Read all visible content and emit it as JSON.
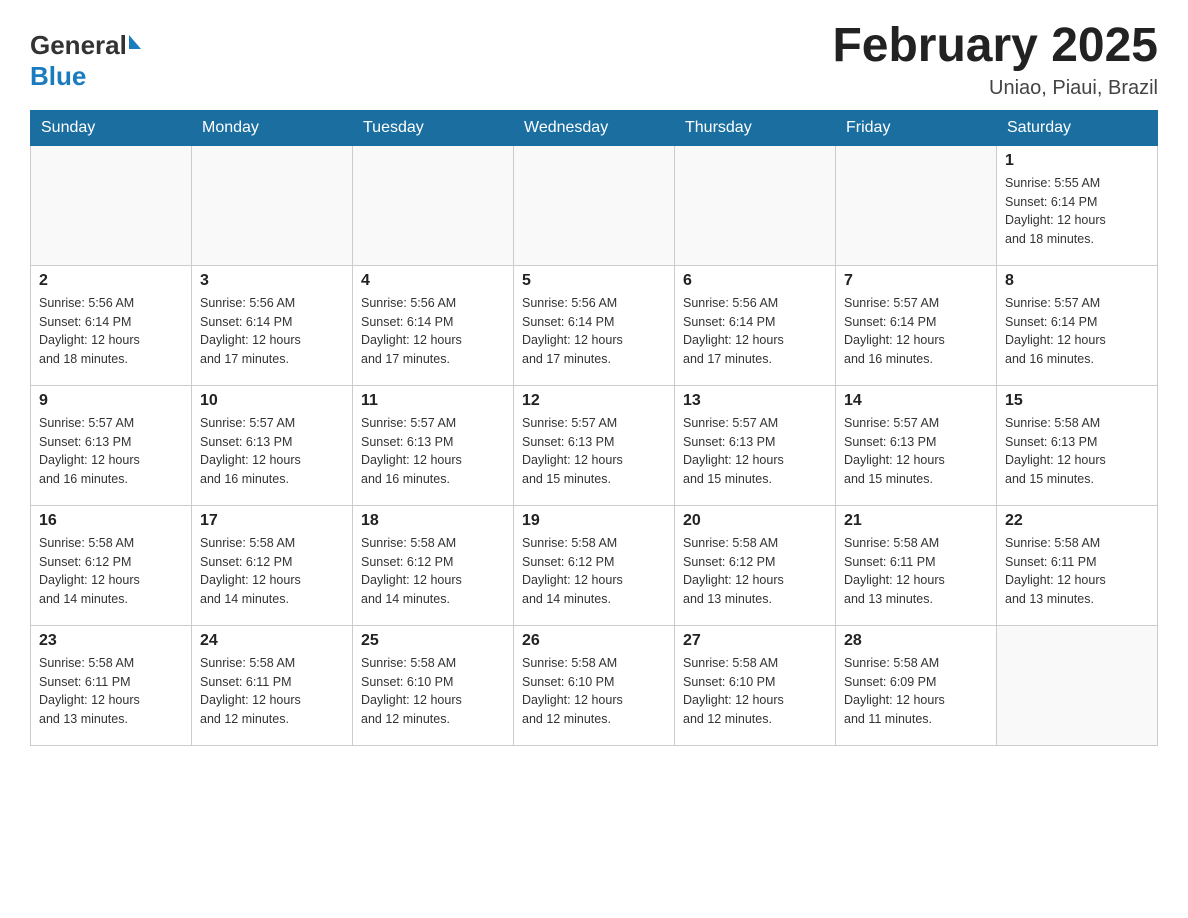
{
  "header": {
    "logo_general": "General",
    "logo_blue": "Blue",
    "month_title": "February 2025",
    "location": "Uniao, Piaui, Brazil"
  },
  "days_of_week": [
    "Sunday",
    "Monday",
    "Tuesday",
    "Wednesday",
    "Thursday",
    "Friday",
    "Saturday"
  ],
  "weeks": [
    [
      {
        "day": "",
        "info": ""
      },
      {
        "day": "",
        "info": ""
      },
      {
        "day": "",
        "info": ""
      },
      {
        "day": "",
        "info": ""
      },
      {
        "day": "",
        "info": ""
      },
      {
        "day": "",
        "info": ""
      },
      {
        "day": "1",
        "info": "Sunrise: 5:55 AM\nSunset: 6:14 PM\nDaylight: 12 hours\nand 18 minutes."
      }
    ],
    [
      {
        "day": "2",
        "info": "Sunrise: 5:56 AM\nSunset: 6:14 PM\nDaylight: 12 hours\nand 18 minutes."
      },
      {
        "day": "3",
        "info": "Sunrise: 5:56 AM\nSunset: 6:14 PM\nDaylight: 12 hours\nand 17 minutes."
      },
      {
        "day": "4",
        "info": "Sunrise: 5:56 AM\nSunset: 6:14 PM\nDaylight: 12 hours\nand 17 minutes."
      },
      {
        "day": "5",
        "info": "Sunrise: 5:56 AM\nSunset: 6:14 PM\nDaylight: 12 hours\nand 17 minutes."
      },
      {
        "day": "6",
        "info": "Sunrise: 5:56 AM\nSunset: 6:14 PM\nDaylight: 12 hours\nand 17 minutes."
      },
      {
        "day": "7",
        "info": "Sunrise: 5:57 AM\nSunset: 6:14 PM\nDaylight: 12 hours\nand 16 minutes."
      },
      {
        "day": "8",
        "info": "Sunrise: 5:57 AM\nSunset: 6:14 PM\nDaylight: 12 hours\nand 16 minutes."
      }
    ],
    [
      {
        "day": "9",
        "info": "Sunrise: 5:57 AM\nSunset: 6:13 PM\nDaylight: 12 hours\nand 16 minutes."
      },
      {
        "day": "10",
        "info": "Sunrise: 5:57 AM\nSunset: 6:13 PM\nDaylight: 12 hours\nand 16 minutes."
      },
      {
        "day": "11",
        "info": "Sunrise: 5:57 AM\nSunset: 6:13 PM\nDaylight: 12 hours\nand 16 minutes."
      },
      {
        "day": "12",
        "info": "Sunrise: 5:57 AM\nSunset: 6:13 PM\nDaylight: 12 hours\nand 15 minutes."
      },
      {
        "day": "13",
        "info": "Sunrise: 5:57 AM\nSunset: 6:13 PM\nDaylight: 12 hours\nand 15 minutes."
      },
      {
        "day": "14",
        "info": "Sunrise: 5:57 AM\nSunset: 6:13 PM\nDaylight: 12 hours\nand 15 minutes."
      },
      {
        "day": "15",
        "info": "Sunrise: 5:58 AM\nSunset: 6:13 PM\nDaylight: 12 hours\nand 15 minutes."
      }
    ],
    [
      {
        "day": "16",
        "info": "Sunrise: 5:58 AM\nSunset: 6:12 PM\nDaylight: 12 hours\nand 14 minutes."
      },
      {
        "day": "17",
        "info": "Sunrise: 5:58 AM\nSunset: 6:12 PM\nDaylight: 12 hours\nand 14 minutes."
      },
      {
        "day": "18",
        "info": "Sunrise: 5:58 AM\nSunset: 6:12 PM\nDaylight: 12 hours\nand 14 minutes."
      },
      {
        "day": "19",
        "info": "Sunrise: 5:58 AM\nSunset: 6:12 PM\nDaylight: 12 hours\nand 14 minutes."
      },
      {
        "day": "20",
        "info": "Sunrise: 5:58 AM\nSunset: 6:12 PM\nDaylight: 12 hours\nand 13 minutes."
      },
      {
        "day": "21",
        "info": "Sunrise: 5:58 AM\nSunset: 6:11 PM\nDaylight: 12 hours\nand 13 minutes."
      },
      {
        "day": "22",
        "info": "Sunrise: 5:58 AM\nSunset: 6:11 PM\nDaylight: 12 hours\nand 13 minutes."
      }
    ],
    [
      {
        "day": "23",
        "info": "Sunrise: 5:58 AM\nSunset: 6:11 PM\nDaylight: 12 hours\nand 13 minutes."
      },
      {
        "day": "24",
        "info": "Sunrise: 5:58 AM\nSunset: 6:11 PM\nDaylight: 12 hours\nand 12 minutes."
      },
      {
        "day": "25",
        "info": "Sunrise: 5:58 AM\nSunset: 6:10 PM\nDaylight: 12 hours\nand 12 minutes."
      },
      {
        "day": "26",
        "info": "Sunrise: 5:58 AM\nSunset: 6:10 PM\nDaylight: 12 hours\nand 12 minutes."
      },
      {
        "day": "27",
        "info": "Sunrise: 5:58 AM\nSunset: 6:10 PM\nDaylight: 12 hours\nand 12 minutes."
      },
      {
        "day": "28",
        "info": "Sunrise: 5:58 AM\nSunset: 6:09 PM\nDaylight: 12 hours\nand 11 minutes."
      },
      {
        "day": "",
        "info": ""
      }
    ]
  ]
}
